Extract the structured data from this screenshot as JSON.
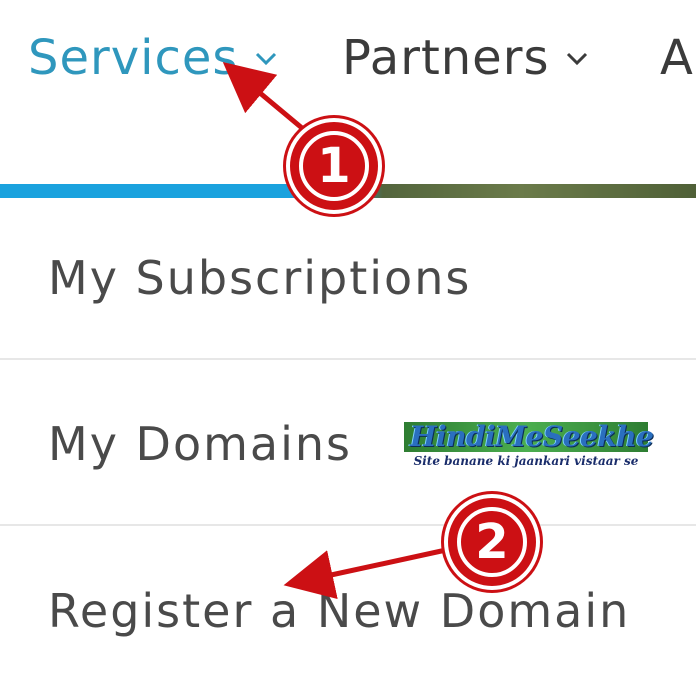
{
  "nav": {
    "items": [
      {
        "label": "Services",
        "active": true,
        "color": "#2f97bd"
      },
      {
        "label": "Partners",
        "active": false,
        "color": "#3b3b3b"
      },
      {
        "label": "A",
        "active": false,
        "color": "#3b3b3b"
      }
    ]
  },
  "menu": {
    "items": [
      {
        "label": "My Subscriptions"
      },
      {
        "label": "My Domains"
      },
      {
        "label": "Register a New Domain"
      }
    ]
  },
  "watermark": {
    "title": "HindiMeSeekhe",
    "subtitle": "Site banane ki jaankari vistaar se"
  },
  "annotations": {
    "marker_1": "1",
    "marker_2": "2",
    "color": "#cc1014"
  },
  "colors": {
    "accent": "#2f97bd",
    "band_blue": "#1aa2de",
    "band_green": "#53653d"
  }
}
